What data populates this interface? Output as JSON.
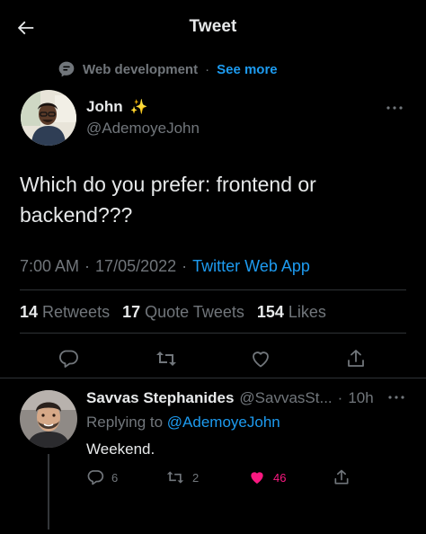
{
  "header": {
    "title": "Tweet"
  },
  "topic": {
    "label": "Web development",
    "separator": "·",
    "see_more": "See more"
  },
  "tweet": {
    "author_name": "John",
    "author_emoji": "✨",
    "author_handle": "@AdemoyeJohn",
    "text": "Which do you prefer: frontend or backend???",
    "time": "7:00 AM",
    "date": "17/05/2022",
    "dot1": "·",
    "dot2": "·",
    "source": "Twitter Web App",
    "retweets_count": "14",
    "retweets_label": "Retweets",
    "quotes_count": "17",
    "quotes_label": "Quote Tweets",
    "likes_count": "154",
    "likes_label": "Likes"
  },
  "reply": {
    "name": "Savvas Stephanides",
    "handle": "@SavvasSt...",
    "separator": "·",
    "time": "10h",
    "replying_to_label": "Replying to",
    "mention": "@AdemoyeJohn",
    "text": "Weekend.",
    "reply_count": "6",
    "retweet_count": "2",
    "like_count": "46"
  },
  "colors": {
    "accent": "#1d9bf0",
    "like": "#f91880",
    "muted": "#71767b",
    "background": "#000000"
  },
  "icons": [
    "back-arrow-icon",
    "topic-icon",
    "sparkles-icon",
    "more-icon",
    "reply-icon",
    "retweet-icon",
    "like-icon",
    "share-icon"
  ]
}
